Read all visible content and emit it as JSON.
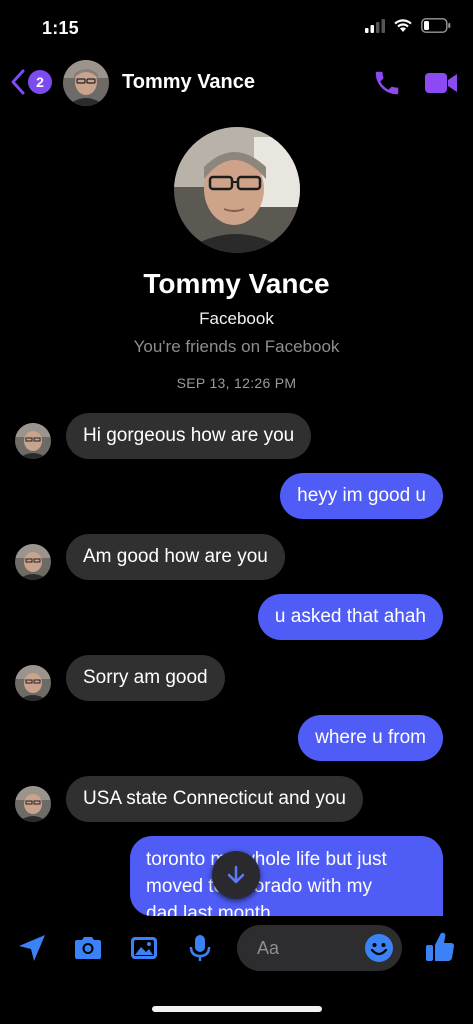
{
  "status": {
    "time": "1:15"
  },
  "header": {
    "back_badge": "2",
    "contact_name": "Tommy Vance"
  },
  "profile": {
    "name": "Tommy Vance",
    "platform": "Facebook",
    "relationship": "You're friends on Facebook",
    "timestamp": "SEP 13, 12:26 PM"
  },
  "messages": [
    {
      "direction": "in",
      "text": "Hi gorgeous how are you"
    },
    {
      "direction": "out",
      "text": "heyy im good u"
    },
    {
      "direction": "in",
      "text": "Am good how are you"
    },
    {
      "direction": "out",
      "text": "u asked that ahah"
    },
    {
      "direction": "in",
      "text": "Sorry am good"
    },
    {
      "direction": "out",
      "text": "where u from"
    },
    {
      "direction": "in",
      "text": "USA state Connecticut and you"
    },
    {
      "direction": "out",
      "lines": [
        "toronto my whole life but just",
        "moved to colorado with my",
        "dad last month"
      ]
    }
  ],
  "composer": {
    "placeholder": "Aa"
  },
  "colors": {
    "accent": "#7d4cf0",
    "outgoing_bubble": "#4f5df6",
    "incoming_bubble": "#303030",
    "background": "#000000"
  },
  "icons": [
    "back-chevron-icon",
    "phone-icon",
    "video-camera-icon",
    "location-arrow-icon",
    "camera-icon",
    "image-icon",
    "microphone-icon",
    "emoji-icon",
    "thumbs-up-icon",
    "arrow-down-icon"
  ]
}
